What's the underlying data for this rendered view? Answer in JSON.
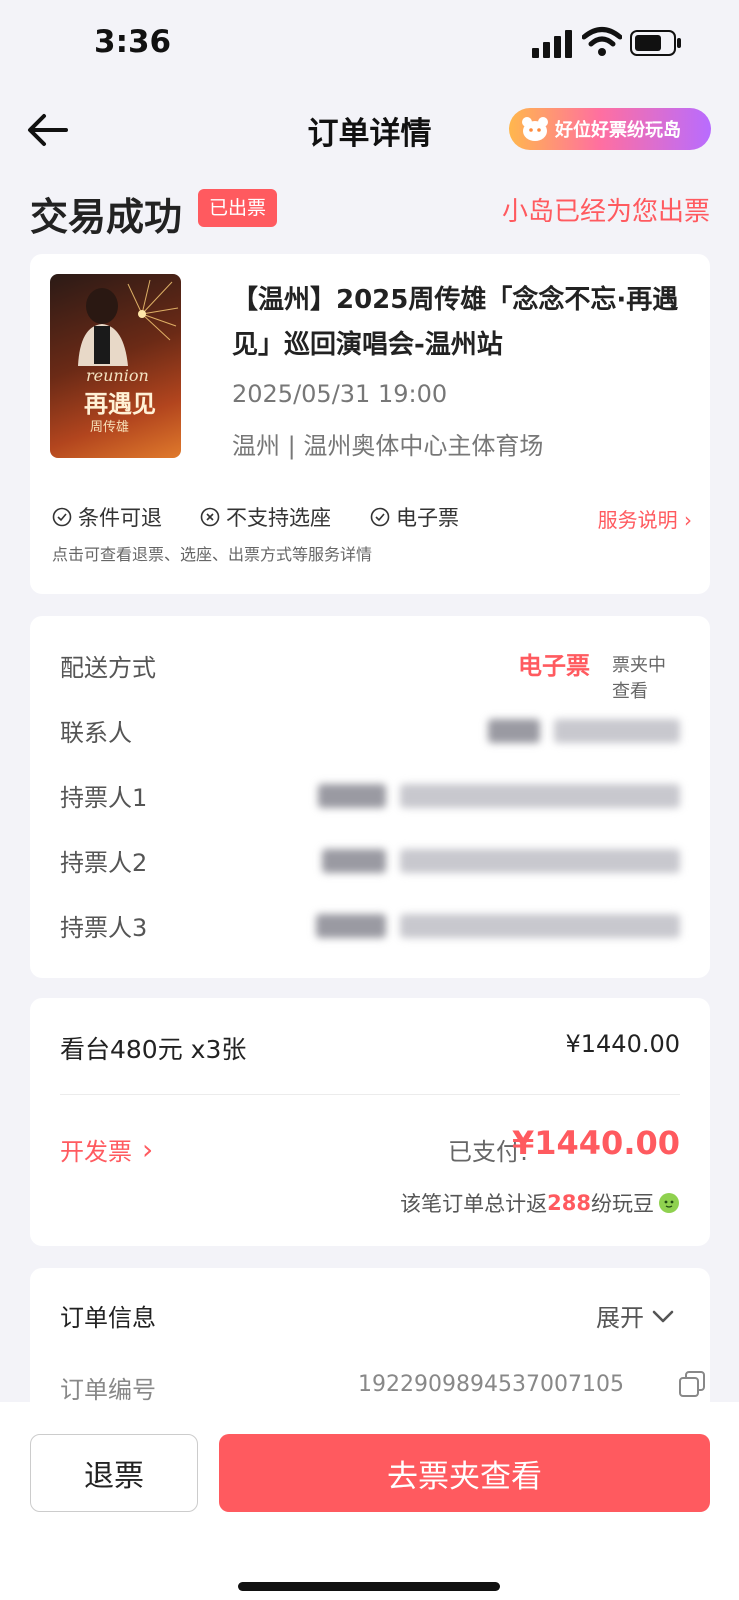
{
  "status_bar": {
    "time": "3:36"
  },
  "nav": {
    "title": "订单详情",
    "promo": "好位好票纷玩岛"
  },
  "order_status": {
    "title": "交易成功",
    "badge": "已出票",
    "note": "小岛已经为您出票"
  },
  "event": {
    "title": "【温州】2025周传雄「念念不忘·再遇见」巡回演唱会-温州站",
    "datetime": "2025/05/31 19:00",
    "venue": "温州 | 温州奥体中心主体育场",
    "poster": {
      "line1": "reunion",
      "line2": "再遇见",
      "line3": "周传雄"
    }
  },
  "services": {
    "items": [
      "条件可退",
      "不支持选座",
      "电子票"
    ],
    "link": "服务说明",
    "description": "点击可查看退票、选座、出票方式等服务详情"
  },
  "delivery": {
    "rows": [
      {
        "label": "配送方式",
        "value_highlight": "电子票",
        "value": "票夹中查看"
      },
      {
        "label": "联系人"
      },
      {
        "label": "持票人1"
      },
      {
        "label": "持票人2"
      },
      {
        "label": "持票人3"
      }
    ]
  },
  "payment": {
    "item": "看台480元 x3张",
    "item_total": "¥1440.00",
    "invoice": "开发票",
    "paid_label": "已支付:",
    "paid_amount": "¥1440.00",
    "points_prefix": "该笔订单总计返",
    "points": "288",
    "points_suffix": "纷玩豆"
  },
  "order_info": {
    "title": "订单信息",
    "expand": "展开",
    "number_label": "订单编号",
    "number": "1922909894537007105"
  },
  "actions": {
    "refund": "退票",
    "primary": "去票夹查看"
  },
  "colors": {
    "accent": "#ff5a5f",
    "background": "#f3f3f8"
  }
}
